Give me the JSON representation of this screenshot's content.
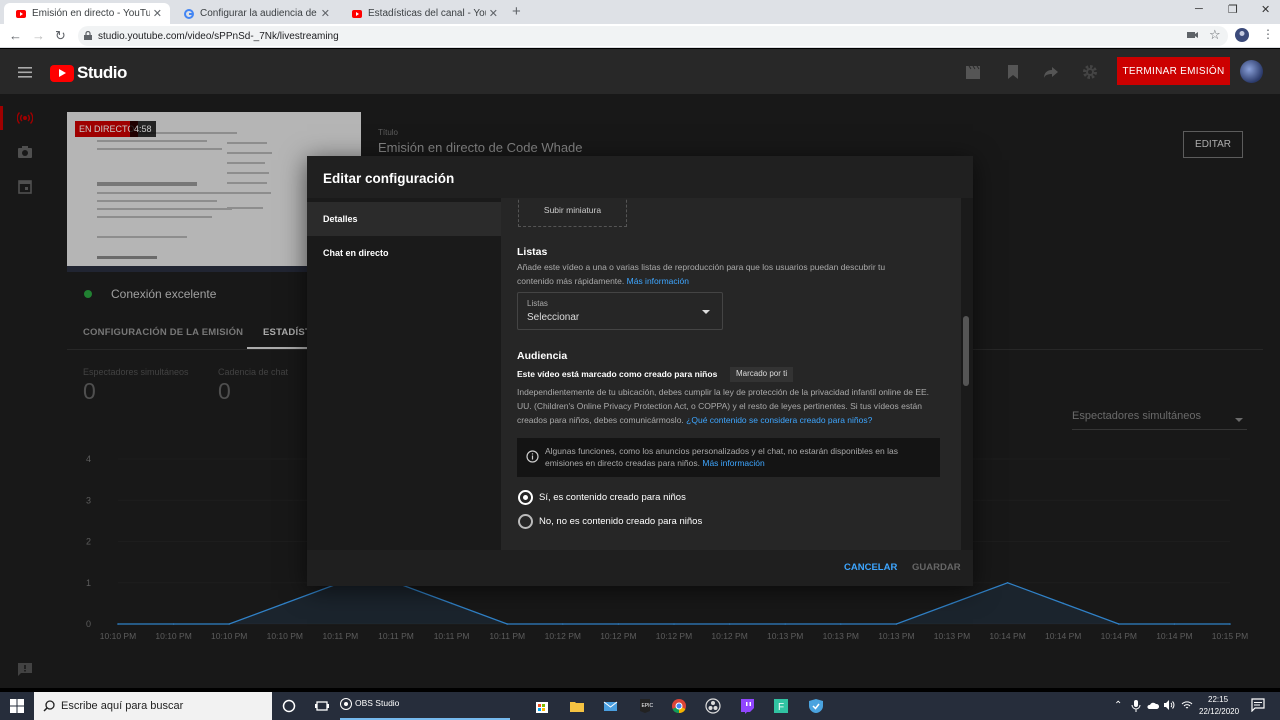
{
  "browser": {
    "tabs": [
      {
        "title": "Emisión en directo - YouTube Studio",
        "favicon": "youtube-icon",
        "active": true
      },
      {
        "title": "Configurar la audiencia de un video",
        "favicon": "google-icon",
        "active": false
      },
      {
        "title": "Estadísticas del canal - YouTube",
        "favicon": "youtube-icon",
        "active": false
      }
    ],
    "url": "studio.youtube.com/video/sPPnSd-_7Nk/livestreaming"
  },
  "header": {
    "logo_text": "Studio",
    "end_stream_label": "TERMINAR EMISIÓN",
    "accent": "#cc0000"
  },
  "stream": {
    "live_badge": "EN DIRECTO",
    "elapsed": "4:58",
    "connection": "Conexión excelente",
    "title_label": "Título",
    "title_value": "Emisión en directo de Code Whade",
    "edit_label": "EDITAR",
    "tab_config": "CONFIGURACIÓN DE LA EMISIÓN",
    "tab_stats": "ESTADÍST",
    "stats": [
      {
        "label": "Espectadores simultáneos",
        "value": "0"
      },
      {
        "label": "Cadencia de chat",
        "value": "0"
      }
    ],
    "metric_select": "Espectadores simultáneos"
  },
  "chart_data": {
    "type": "area",
    "y_ticks": [
      "0",
      "1",
      "2",
      "3",
      "4"
    ],
    "ylim": [
      0,
      4
    ],
    "x_labels": [
      "10:10 PM",
      "10:10 PM",
      "10:10 PM",
      "10:10 PM",
      "10:11 PM",
      "10:11 PM",
      "10:11 PM",
      "10:11 PM",
      "10:12 PM",
      "10:12 PM",
      "10:12 PM",
      "10:12 PM",
      "10:13 PM",
      "10:13 PM",
      "10:13 PM",
      "10:13 PM",
      "10:14 PM",
      "10:14 PM",
      "10:14 PM",
      "10:14 PM",
      "10:15 PM"
    ],
    "values": [
      0,
      0,
      0,
      0.5,
      1,
      1,
      0.5,
      0,
      0,
      0,
      0,
      0,
      0,
      0,
      0,
      0.5,
      1,
      0.5,
      0,
      0,
      0
    ],
    "series_color": "#3ea6ff"
  },
  "dialog": {
    "title": "Editar configuración",
    "nav": [
      "Detalles",
      "Chat en directo"
    ],
    "upload_thumbnail": "Subir miniatura",
    "playlists": {
      "heading": "Listas",
      "description": "Añade este vídeo a una o varias listas de reproducción para que los usuarios puedan descubrir tu contenido más rápidamente.",
      "more_info": "Más información",
      "select_label": "Listas",
      "select_value": "Seleccionar"
    },
    "audience": {
      "heading": "Audiencia",
      "status_text": "Este vídeo está marcado como creado para niños",
      "status_chip": "Marcado por ti",
      "legal_text": "Independientemente de tu ubicación, debes cumplir la ley de protección de la privacidad infantil online de EE. UU. (Children's Online Privacy Protection Act, o COPPA) y el resto de leyes pertinentes. Si tus vídeos están creados para niños, debes comunicármoslo.",
      "legal_link": "¿Qué contenido se considera creado para niños?",
      "info_text": "Algunas funciones, como los anuncios personalizados y el chat, no estarán disponibles en las emisiones en directo creadas para niños.",
      "info_link": "Más información",
      "option_yes": "Sí, es contenido creado para niños",
      "option_no": "No, no es contenido creado para niños",
      "selected": "yes"
    },
    "cancel_label": "CANCELAR",
    "save_label": "GUARDAR"
  },
  "taskbar": {
    "search_placeholder": "Escribe aquí para buscar",
    "obs_label": "OBS Studio",
    "time": "22:15",
    "date": "22/12/2020"
  }
}
